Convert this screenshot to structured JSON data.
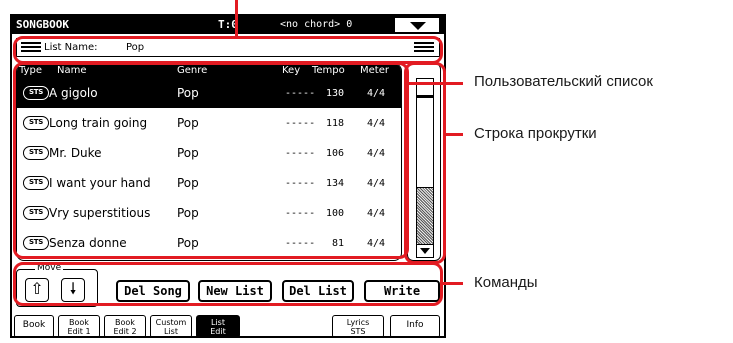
{
  "titlebar": {
    "name": "SONGBOOK",
    "tempo": "T:0",
    "chord": "<no chord> 0"
  },
  "list_name": {
    "label": "List Name:",
    "value": "Pop"
  },
  "table": {
    "headers": [
      "Type",
      "Name",
      "Genre",
      "Key",
      "Tempo",
      "Meter"
    ],
    "rows": [
      {
        "type": "STS",
        "name": "A gigolo",
        "genre": "Pop",
        "key": "-----",
        "tempo": "130",
        "meter": "4/4"
      },
      {
        "type": "STS",
        "name": "Long train going",
        "genre": "Pop",
        "key": "-----",
        "tempo": "118",
        "meter": "4/4"
      },
      {
        "type": "STS",
        "name": "Mr. Duke",
        "genre": "Pop",
        "key": "-----",
        "tempo": "106",
        "meter": "4/4"
      },
      {
        "type": "STS",
        "name": "I want your hand",
        "genre": "Pop",
        "key": "-----",
        "tempo": "134",
        "meter": "4/4"
      },
      {
        "type": "STS",
        "name": "Vry superstitious",
        "genre": "Pop",
        "key": "-----",
        "tempo": "100",
        "meter": "4/4"
      },
      {
        "type": "STS",
        "name": "Senza donne",
        "genre": "Pop",
        "key": "-----",
        "tempo": "81",
        "meter": "4/4"
      }
    ],
    "selected_index": 0
  },
  "move": {
    "label": "Move",
    "up_icon": "arrow-up-icon",
    "down_icon": "arrow-down-icon"
  },
  "commands": {
    "del_song": "Del Song",
    "new_list": "New List",
    "del_list": "Del List",
    "write": "Write"
  },
  "tabs": {
    "book": "Book",
    "book_edit1_l1": "Book",
    "book_edit1_l2": "Edit 1",
    "book_edit2_l1": "Book",
    "book_edit2_l2": "Edit 2",
    "custom_l1": "Custom",
    "custom_l2": "List",
    "list_edit_l1": "List",
    "list_edit_l2": "Edit",
    "lyrics_l1": "Lyrics",
    "lyrics_l2": "STS",
    "info": "Info"
  },
  "callouts": {
    "user_list": "Пользовательский список",
    "scroll_bar": "Строка прокрутки",
    "commands": "Команды"
  },
  "colors": {
    "highlight": "#e21b22",
    "screen_fg": "#000000",
    "screen_bg": "#ffffff"
  }
}
